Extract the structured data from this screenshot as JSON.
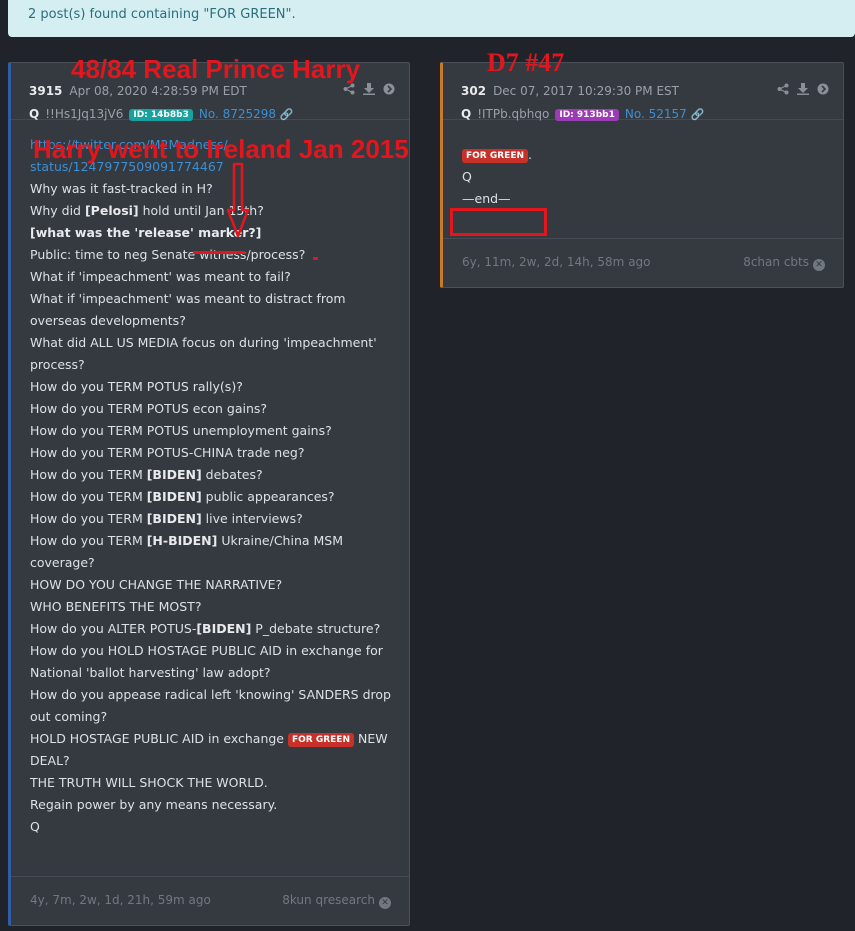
{
  "banner": {
    "text": "2 post(s) found containing \"FOR GREEN\"."
  },
  "annotations": {
    "left_title": "48/84  Real Prince Harry",
    "left_note": "Harry went to Ireland Jan 2015",
    "right_title": "D7 #47",
    "color": "#e3161e"
  },
  "posts": [
    {
      "number": "3915",
      "date": "Apr 08, 2020 4:28:59 PM EDT",
      "author": "Q",
      "tripcode": "!!Hs1Jq13jV6",
      "id_badge": "ID: 14b8b3",
      "post_no": "No. 8725298",
      "icons": [
        "share-icon",
        "download-icon",
        "forward-icon"
      ],
      "footer_ago": "4y, 7m, 2w, 1d, 21h, 59m ago",
      "footer_source": "8kun qresearch",
      "lines": {
        "link1": "https://twitter.com/M2Madness/",
        "link2": "status/1247977509091774467",
        "l1": "Why was it fast-tracked in H?",
        "l2a": "Why did ",
        "l2b": "[Pelosi]",
        "l2c": " hold until ",
        "l2d": "Jan 15th",
        "l2e": "?",
        "l3": "[what was the 'release' marker?]",
        "l4": "Public: time to neg Senate witness/process?",
        "l5": "What if 'impeachment' was meant to fail?",
        "l6": "What if 'impeachment' was meant to distract from",
        "l7": "overseas developments?",
        "l8": "What did ALL US MEDIA focus on during 'impeachment'",
        "l9": "process?",
        "l10": "How do you TERM POTUS rally(s)?",
        "l11": "How do you TERM POTUS econ gains?",
        "l12": "How do you TERM POTUS unemployment gains?",
        "l13": "How do you TERM POTUS-CHINA trade neg?",
        "l14a": "How do you TERM ",
        "l14b": "[BIDEN]",
        "l14c": " debates?",
        "l15a": "How do you TERM ",
        "l15b": "[BIDEN]",
        "l15c": " public appearances?",
        "l16a": "How do you TERM ",
        "l16b": "[BIDEN]",
        "l16c": " live interviews?",
        "l17a": "How do you TERM ",
        "l17b": "[H-BIDEN]",
        "l17c": " Ukraine/China MSM",
        "l18": "coverage?",
        "l19": "HOW DO YOU CHANGE THE NARRATIVE?",
        "l20": "WHO BENEFITS THE MOST?",
        "l21a": "How do you ALTER POTUS-",
        "l21b": "[BIDEN]",
        "l21c": " P_debate structure?",
        "l22": "How do you HOLD HOSTAGE PUBLIC AID in exchange for",
        "l23": "National 'ballot harvesting' law adopt?",
        "l24": "How do you appease radical left 'knowing' SANDERS drop",
        "l25": "out coming?",
        "l26a": "HOLD HOSTAGE PUBLIC AID in exchange ",
        "l26tag": "FOR GREEN",
        "l26c": " NEW",
        "l27": "DEAL?",
        "l28": "THE TRUTH WILL SHOCK THE WORLD.",
        "l29": "Regain power by any means necessary.",
        "l30": "Q"
      }
    },
    {
      "number": "302",
      "date": "Dec 07, 2017 10:29:30 PM EST",
      "author": "Q",
      "tripcode": "!ITPb.qbhqo",
      "id_badge": "ID: 913bb1",
      "post_no": "No. 52157",
      "icons": [
        "share-icon",
        "download-icon",
        "forward-icon"
      ],
      "footer_ago": "6y, 11m, 2w, 2d, 14h, 58m ago",
      "footer_source": "8chan cbts",
      "lines": {
        "tag": "FOR GREEN",
        "tag_after": ".",
        "sig": "Q",
        "end": "—end—"
      }
    }
  ]
}
